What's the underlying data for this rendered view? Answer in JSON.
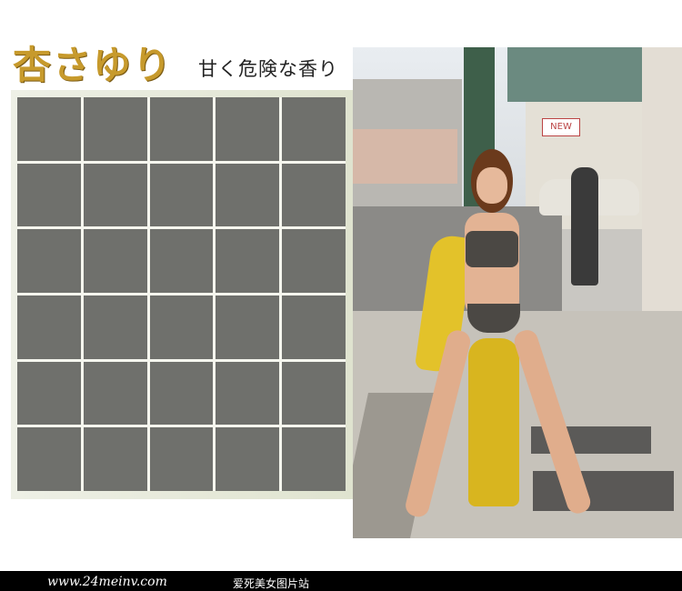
{
  "header": {
    "title": "杏さゆり",
    "subtitle": "甘く危険な香り"
  },
  "grid": {
    "columns": 5,
    "rows": 6
  },
  "photo": {
    "sign_text": "NEW"
  },
  "footer": {
    "url": "www.24meinv.com",
    "site_name": "爱死美女图片站"
  },
  "colors": {
    "title_gold": "#c79a2c",
    "tile_gray": "#6f706c",
    "footer_bg": "#000000"
  }
}
